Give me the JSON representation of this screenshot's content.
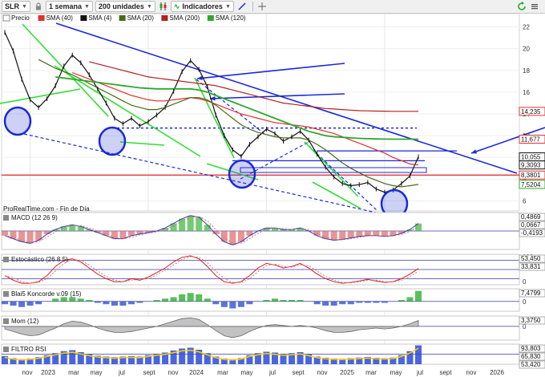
{
  "toolbar": {
    "symbol": "SLR",
    "period": "1 semana",
    "units": "200 unidades",
    "indicators": "Indicadores"
  },
  "watermark": "ProRealTime.com - Fin de Día",
  "colors": {
    "price": "#111111",
    "sma40": "#e03030",
    "sma4": "#111111",
    "sma20": "#4a6a1a",
    "sma200": "#b02020",
    "sma120": "#2ea82e",
    "trend_blue": "#1a2ad8",
    "support_red": "#dd2222",
    "green_line": "#33dd33"
  },
  "legend": [
    {
      "label": "Precio",
      "color": "#111111"
    },
    {
      "label": "SMA (40)",
      "color": "#e03030"
    },
    {
      "label": "SMA (4)",
      "color": "#111111"
    },
    {
      "label": "SMA (20)",
      "color": "#4a6a1a"
    },
    {
      "label": "SMA (200)",
      "color": "#b02020"
    },
    {
      "label": "SMA (120)",
      "color": "#2ea82e"
    }
  ],
  "price_axis": {
    "ticks": [
      "22",
      "20",
      "18",
      "16",
      "14",
      "12",
      "10",
      "8",
      "6"
    ]
  },
  "price_tags": [
    {
      "text": "14,235",
      "value": 14.235,
      "color": "#e03030"
    },
    {
      "text": "11,677",
      "value": 11.677,
      "color": "#e03030"
    },
    {
      "text": "10,055",
      "value": 10.055,
      "color": "#111111"
    },
    {
      "text": "9,3093",
      "value": 9.3093,
      "color": "#111111"
    },
    {
      "text": "8,3801",
      "value": 8.3801,
      "color": "#e03030"
    },
    {
      "text": "7,5204",
      "value": 7.5204,
      "color": "#2ea82e"
    }
  ],
  "x_axis": {
    "labels": [
      "nov",
      "2023",
      "mar",
      "may",
      "jul",
      "sept",
      "nov",
      "2024",
      "mar",
      "may",
      "jul",
      "sept",
      "nov",
      "2025",
      "mar",
      "may",
      "jul",
      "sept",
      "nov",
      "2026"
    ]
  },
  "panels": [
    {
      "name": "MACD (12 26 9)",
      "tags": [
        "0,4869",
        "0,0667",
        "-0,4193"
      ],
      "axis": [
        "0"
      ]
    },
    {
      "name": "Estocástico (26.8 5)",
      "tags": [
        "53,450",
        "33,831"
      ],
      "axis": [
        "100",
        "0"
      ]
    },
    {
      "name": "Blai5 Koncorde v.09 (15)",
      "tags": [
        "7,4799"
      ],
      "axis": [
        "0"
      ]
    },
    {
      "name": "Mom (12)",
      "tags": [
        "3,3750"
      ],
      "axis": [
        "0"
      ]
    },
    {
      "name": "FILTRO RSI",
      "tags": [
        "93,803",
        "65,830",
        "53,420"
      ],
      "axis": [
        "0"
      ]
    }
  ],
  "chart_data": {
    "type": "line",
    "x_start": "2022-10",
    "x_end": "2026-02",
    "ylim": [
      5.3,
      23
    ],
    "series": [
      {
        "name": "Precio",
        "values": [
          21.5,
          19.8,
          17.2,
          15.3,
          14.6,
          15.4,
          16.6,
          18.4,
          19.4,
          18.7,
          17.6,
          16.3,
          15.0,
          13.6,
          13.1,
          13.6,
          12.9,
          13.3,
          13.9,
          14.6,
          16.1,
          17.9,
          18.9,
          18.1,
          16.5,
          13.9,
          12.0,
          10.7,
          10.1,
          11.2,
          11.9,
          12.6,
          12.2,
          11.5,
          11.9,
          12.4,
          11.6,
          10.3,
          9.1,
          8.2,
          7.6,
          7.4,
          7.5,
          7.7,
          7.1,
          6.8,
          7.0,
          7.6,
          8.3,
          10.055
        ]
      },
      {
        "name": "SMA (40)",
        "values": [
          null,
          null,
          null,
          null,
          null,
          null,
          null,
          null,
          17.8,
          17.5,
          17.2,
          16.9,
          16.6,
          16.3,
          16.0,
          15.7,
          15.5,
          15.3,
          15.2,
          15.2,
          15.3,
          15.4,
          15.5,
          15.4,
          15.2,
          14.9,
          14.6,
          14.3,
          14.0,
          13.8,
          13.6,
          13.4,
          13.2,
          13.1,
          13.0,
          12.9,
          12.8,
          12.6,
          12.4,
          12.2,
          11.9,
          11.6,
          11.3,
          11.0,
          10.7,
          10.4,
          10.0,
          9.7,
          9.4,
          9.3093
        ]
      },
      {
        "name": "SMA (20)",
        "values": [
          null,
          null,
          null,
          null,
          19.0,
          18.6,
          18.2,
          17.9,
          17.6,
          17.2,
          16.8,
          16.4,
          16.0,
          15.6,
          15.2,
          14.8,
          14.6,
          14.4,
          14.4,
          14.6,
          14.9,
          15.2,
          15.5,
          15.5,
          15.3,
          14.8,
          14.2,
          13.6,
          13.0,
          12.6,
          12.3,
          12.1,
          11.9,
          11.8,
          11.8,
          11.8,
          11.6,
          11.2,
          10.7,
          10.1,
          9.5,
          9.0,
          8.6,
          8.2,
          7.9,
          7.6,
          7.4,
          7.3,
          7.4,
          7.5204
        ]
      },
      {
        "name": "SMA (200)",
        "values": [
          null,
          null,
          null,
          null,
          null,
          null,
          null,
          null,
          null,
          null,
          18.8,
          18.6,
          18.4,
          18.2,
          18.0,
          17.8,
          17.6,
          17.4,
          17.3,
          17.2,
          17.1,
          17.0,
          16.9,
          16.8,
          16.7,
          16.6,
          16.4,
          16.2,
          16.0,
          15.8,
          15.6,
          15.4,
          15.2,
          15.0,
          14.9,
          14.8,
          14.7,
          14.6,
          14.5,
          14.45,
          14.4,
          14.35,
          14.3,
          14.28,
          14.26,
          14.25,
          14.24,
          14.24,
          14.235,
          14.235
        ]
      },
      {
        "name": "SMA (120)",
        "values": [
          null,
          null,
          null,
          null,
          null,
          null,
          17.4,
          17.3,
          17.2,
          17.1,
          17.0,
          16.9,
          16.8,
          16.7,
          16.6,
          16.5,
          16.4,
          16.35,
          16.3,
          16.3,
          16.3,
          16.3,
          16.3,
          16.2,
          16.0,
          15.7,
          15.4,
          15.1,
          14.8,
          14.5,
          14.2,
          13.9,
          13.6,
          13.3,
          13.0,
          12.7,
          12.4,
          12.2,
          12.0,
          11.9,
          11.85,
          11.8,
          11.75,
          11.72,
          11.7,
          11.69,
          11.68,
          11.68,
          11.677,
          11.677
        ]
      }
    ],
    "horizontal_levels": [
      {
        "value": 8.3801,
        "style": "solid",
        "color": "#dd2222"
      },
      {
        "value": 12.7,
        "style": "dashed",
        "color": "#1a2ad8"
      },
      {
        "value": 10.6,
        "style": "solid",
        "color": "#1a2ad8"
      },
      {
        "value": 9.7,
        "style": "solid",
        "color": "#1a2ad8"
      }
    ],
    "oscillators": {
      "macd": [
        -0.3,
        -0.5,
        -0.7,
        -0.8,
        -0.6,
        -0.2,
        0.1,
        0.3,
        0.4,
        0.3,
        0.1,
        -0.1,
        -0.3,
        -0.5,
        -0.5,
        -0.3,
        -0.2,
        -0.1,
        0.0,
        0.2,
        0.5,
        0.8,
        1.0,
        0.9,
        0.4,
        -0.2,
        -0.7,
        -0.9,
        -0.7,
        -0.3,
        0.0,
        0.2,
        0.2,
        0.1,
        0.1,
        0.2,
        0.0,
        -0.3,
        -0.5,
        -0.6,
        -0.55,
        -0.45,
        -0.35,
        -0.3,
        -0.3,
        -0.35,
        -0.3,
        -0.15,
        0.1,
        0.4869
      ],
      "stoch": [
        30,
        15,
        5,
        5,
        10,
        30,
        60,
        80,
        85,
        75,
        55,
        35,
        20,
        10,
        10,
        20,
        15,
        25,
        40,
        55,
        75,
        90,
        95,
        85,
        60,
        30,
        10,
        5,
        10,
        30,
        55,
        70,
        65,
        55,
        60,
        70,
        55,
        35,
        20,
        10,
        5,
        8,
        12,
        18,
        12,
        8,
        10,
        20,
        35,
        53.45
      ],
      "mom": [
        -1.5,
        -3.0,
        -4.5,
        -5.5,
        -5.0,
        -3.0,
        -1.0,
        1.5,
        3.0,
        2.5,
        1.0,
        -1.0,
        -2.5,
        -3.5,
        -3.5,
        -3.0,
        -2.0,
        -1.0,
        0.0,
        1.5,
        3.0,
        4.5,
        5.0,
        4.0,
        1.0,
        -2.5,
        -5.5,
        -6.5,
        -5.5,
        -3.0,
        -1.0,
        0.5,
        1.0,
        0.5,
        0.0,
        0.5,
        0.0,
        -1.0,
        -2.5,
        -3.5,
        -3.5,
        -3.0,
        -2.0,
        -1.5,
        -1.0,
        -1.5,
        -1.0,
        0.0,
        1.5,
        3.375
      ],
      "rsi": [
        40,
        30,
        25,
        28,
        35,
        45,
        55,
        65,
        70,
        60,
        50,
        42,
        38,
        35,
        38,
        40,
        38,
        45,
        52,
        58,
        68,
        78,
        82,
        72,
        55,
        38,
        28,
        25,
        30,
        45,
        55,
        62,
        58,
        52,
        55,
        60,
        50,
        38,
        32,
        28,
        27,
        30,
        33,
        36,
        32,
        30,
        33,
        45,
        65,
        93.803
      ],
      "koncorde": [
        -2,
        -3,
        -4,
        -3,
        -2,
        0,
        2,
        3,
        3,
        2,
        1,
        -1,
        -2,
        -3,
        -3,
        -2,
        -1,
        0,
        1,
        2,
        3,
        5,
        6,
        5,
        2,
        -2,
        -4,
        -5,
        -4,
        -2,
        0,
        1,
        2,
        1,
        1,
        1,
        0,
        -2,
        -3,
        -3,
        -2,
        -2,
        -1,
        -1,
        -1,
        -1,
        0,
        1,
        3,
        7.4799
      ]
    }
  }
}
